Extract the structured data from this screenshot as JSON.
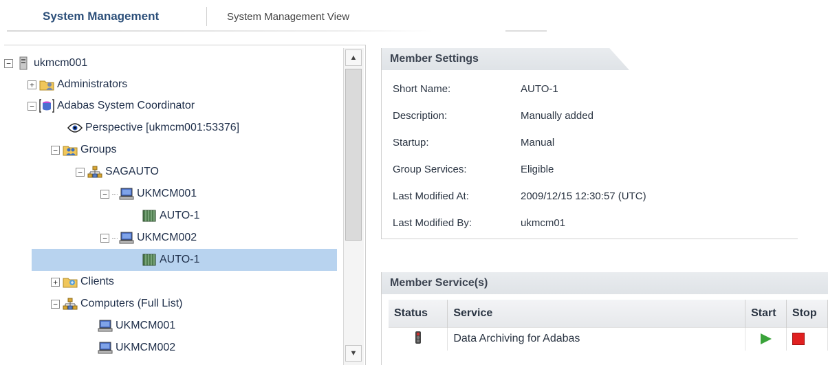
{
  "tabs": {
    "active": "System Management",
    "inactive": "System Management View"
  },
  "tree": {
    "root": "ukmcm001",
    "administrators": "Administrators",
    "coordinator": "Adabas System Coordinator",
    "perspective": "Perspective [ukmcm001:53376]",
    "groups": "Groups",
    "sagauto": "SAGAUTO",
    "host1": "UKMCM001",
    "host1_member": "AUTO-1",
    "host2": "UKMCM002",
    "host2_member": "AUTO-1",
    "clients": "Clients",
    "computers": "Computers (Full List)",
    "computer1": "UKMCM001",
    "computer2": "UKMCM002"
  },
  "member_settings": {
    "title": "Member Settings",
    "rows": [
      {
        "label": "Short Name:",
        "value": "AUTO-1"
      },
      {
        "label": "Description:",
        "value": "Manually added"
      },
      {
        "label": "Startup:",
        "value": "Manual"
      },
      {
        "label": "Group Services:",
        "value": "Eligible"
      },
      {
        "label": "Last Modified At:",
        "value": "2009/12/15 12:30:57 (UTC)"
      },
      {
        "label": "Last Modified By:",
        "value": "ukmcm01"
      }
    ]
  },
  "member_services": {
    "title": "Member Service(s)",
    "columns": {
      "status": "Status",
      "service": "Service",
      "start": "Start",
      "stop": "Stop"
    },
    "rows": [
      {
        "service": "Data Archiving for Adabas"
      }
    ]
  },
  "colors": {
    "selected_row": "#b8d3ef",
    "tab_active": "#2c4f79",
    "start_icon": "#3aa33a",
    "stop_icon": "#e02020"
  }
}
